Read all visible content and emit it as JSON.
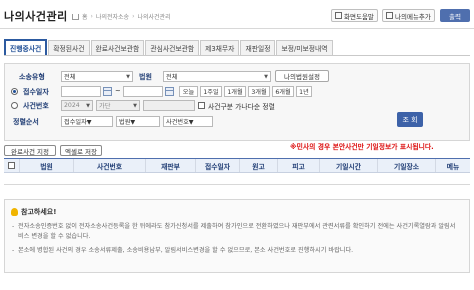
{
  "header": {
    "title": "나의사건관리",
    "breadcrumb": [
      "홈",
      "나의전자소송",
      "나의사건관리"
    ],
    "buttons": {
      "help": "화면도움말",
      "my_menu": "나의메뉴추가",
      "print": "출력"
    }
  },
  "tabs": [
    {
      "label": "진행중사건",
      "active": true
    },
    {
      "label": "확정된사건",
      "active": false
    },
    {
      "label": "완료사건보관함",
      "active": false
    },
    {
      "label": "관심사건보관함",
      "active": false
    },
    {
      "label": "제3채무자",
      "active": false
    },
    {
      "label": "재판일정",
      "active": false
    },
    {
      "label": "보정/미보정내역",
      "active": false
    }
  ],
  "form": {
    "litigation_type": {
      "label": "소송유형",
      "value": "전체"
    },
    "court": {
      "label": "법원",
      "value": "전체",
      "settings_button": "나의법원설정"
    },
    "receipt_date": {
      "label": "접수일자",
      "from": "",
      "to": "",
      "quick": [
        "오늘",
        "1주일",
        "1개월",
        "3개월",
        "6개월",
        "1년"
      ]
    },
    "case_number": {
      "label": "사건번호",
      "year": "2024",
      "type": "가단",
      "value": "",
      "option_label": "사건구분 가나다순 정렬"
    },
    "sort": {
      "label": "정렬순서",
      "values": [
        "접수일자▼",
        "법원▼",
        "사건번호▼"
      ]
    },
    "search_button": "조 회"
  },
  "actions": {
    "complete_button": "완료사건 지정",
    "excel_button": "엑셀로 저장"
  },
  "notice": "※민사의 경우 본안사건만 기일정보가 표시됩니다.",
  "table": {
    "columns": [
      "",
      "법원",
      "사건번호",
      "재판부",
      "접수일자",
      "원고",
      "피고",
      "기일시간",
      "기일장소",
      "메뉴"
    ]
  },
  "info": {
    "title": "참고하세요!",
    "items": [
      "전자소송인증번호 없이 전자소송사건등록을 한 뒤에라도 참가신청서를 제출하여 참가인으로 전환하였으나 재판부에서 관련서류를 확인하기 전에는 사건기록열람과 알림서비스 변경을 할 수 없습니다.",
      "본소에 병합된 사건의 경우 소송서류제출, 소송비용납부, 알림서비스변경을 할 수 없으므로, 본소 사건번호로 진행하시기 바랍니다."
    ]
  },
  "colors": {
    "accent": "#2c5aa0",
    "header_bg": "#eaf0f9",
    "notice": "#dd1111"
  }
}
